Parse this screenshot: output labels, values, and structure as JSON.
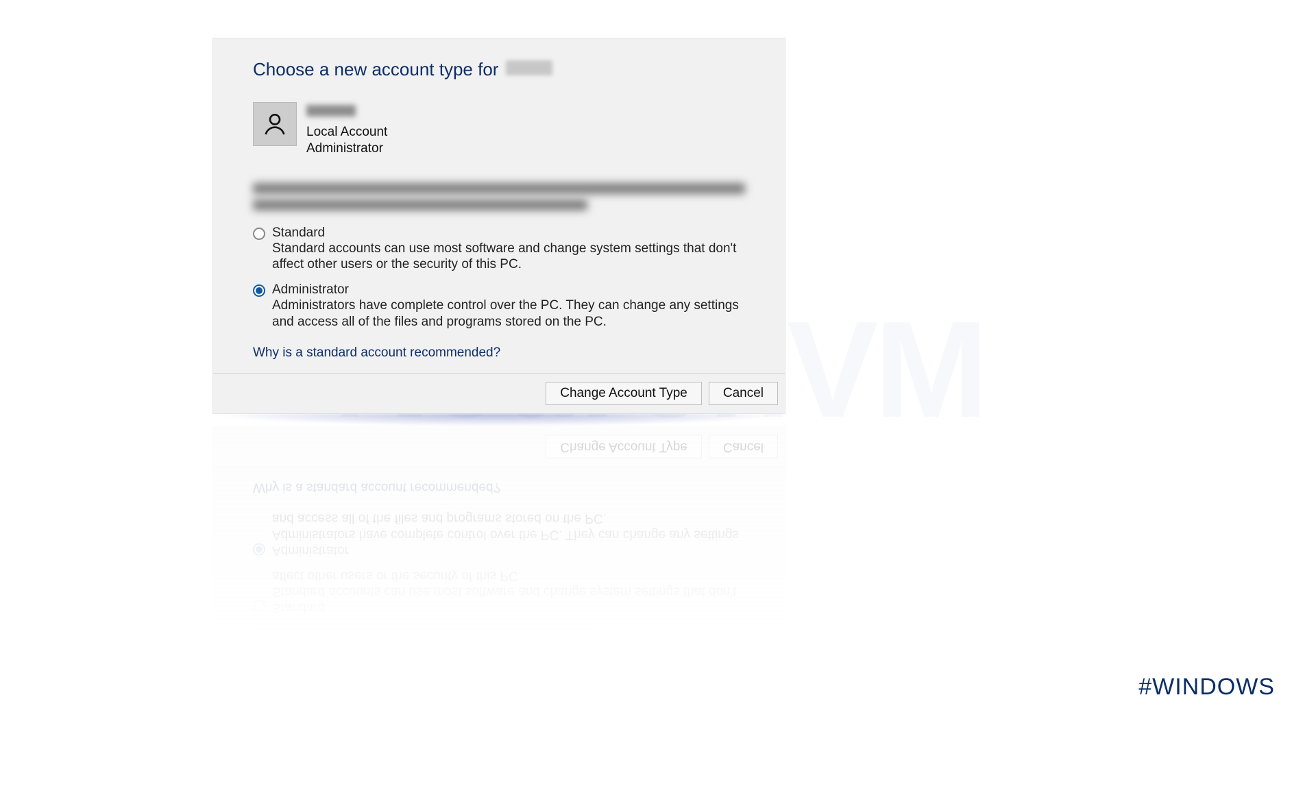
{
  "watermark": "NeuronVM",
  "hashtag": "#WINDOWS",
  "dialog": {
    "title_prefix": "Choose a new account type for",
    "account": {
      "type": "Local Account",
      "role": "Administrator"
    },
    "options": {
      "standard": {
        "label": "Standard",
        "description": "Standard accounts can use most software and change system settings that don't affect other users or the security of this PC.",
        "selected": false
      },
      "administrator": {
        "label": "Administrator",
        "description": "Administrators have complete control over the PC. They can change any settings and access all of the files and programs stored on the PC.",
        "selected": true
      }
    },
    "help_link": "Why is a standard account recommended?",
    "buttons": {
      "change": "Change Account Type",
      "cancel": "Cancel"
    }
  }
}
